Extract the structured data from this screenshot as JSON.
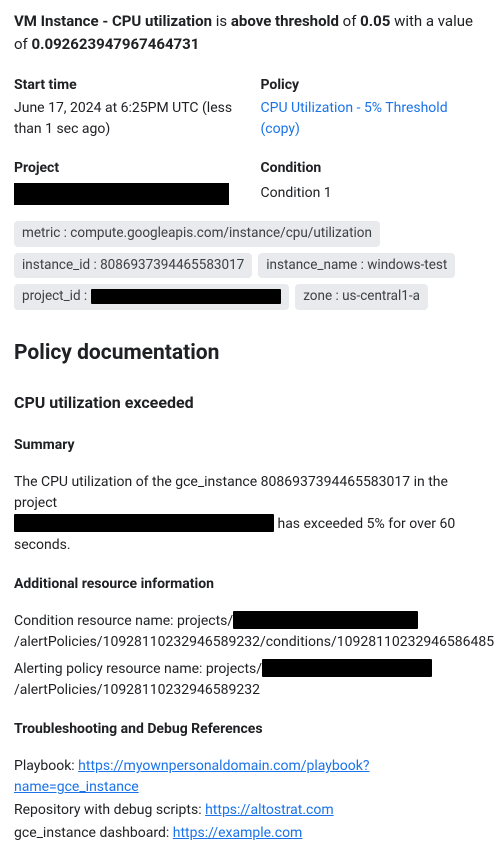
{
  "headline": {
    "strong1": "VM Instance - CPU utilization",
    "plain1": " is ",
    "strong2": "above threshold",
    "plain2": " of ",
    "strong3": "0.05",
    "plain3": " with a value of ",
    "strong4": "0.092623947967464731"
  },
  "meta": {
    "start_label": "Start time",
    "start_value": "June 17, 2024 at 6:25PM UTC (less than 1 sec ago)",
    "policy_label": "Policy",
    "policy_link": "CPU Utilization - 5% Threshold (copy)"
  },
  "proj": {
    "project_label": "Project",
    "condition_label": "Condition",
    "condition_value": "Condition 1"
  },
  "chips": {
    "metric": "metric : compute.googleapis.com/instance/cpu/utilization",
    "instance_id": "instance_id : 8086937394465583017",
    "instance_name": "instance_name : windows-test",
    "project_id_prefix": "project_id : ",
    "zone": "zone : us-central1-a"
  },
  "doc": {
    "title": "Policy documentation",
    "h3": "CPU utilization exceeded",
    "summary_h": "Summary",
    "summary_p1": "The CPU utilization of the gce_instance 8086937394465583017 in the project ",
    "summary_p2": " has exceeded 5% for over 60 seconds.",
    "addl_h": "Additional resource information",
    "cond_pre": "Condition resource name: projects/",
    "cond_post": "/alertPolicies/10928110232946589232/conditions/10928110232946586485",
    "alert_pre": "Alerting policy resource name: projects/",
    "alert_post": "/alertPolicies/10928110232946589232",
    "trouble_h": "Troubleshooting and Debug References",
    "playbook_label": "Playbook: ",
    "playbook_link": "https://myownpersonaldomain.com/playbook?name=gce_instance",
    "repo_label": "Repository with debug scripts: ",
    "repo_link": "https://altostrat.com",
    "dash_label": "gce_instance dashboard: ",
    "dash_link": "https://example.com"
  }
}
